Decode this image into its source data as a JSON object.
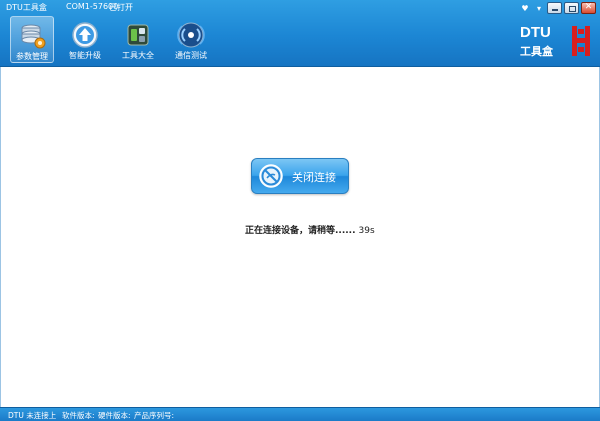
{
  "window": {
    "title": "DTU工具盒",
    "port": "COM1-57600",
    "port_status": "已打开"
  },
  "window_controls": {
    "help_glyph": "♥",
    "dropdown_glyph": "▾",
    "close_glyph": "✕"
  },
  "toolbar": {
    "items": [
      {
        "label": "参数管理",
        "icon": "database-settings-icon",
        "active": true
      },
      {
        "label": "智能升级",
        "icon": "upload-arrow-icon",
        "active": false
      },
      {
        "label": "工具大全",
        "icon": "toolbox-icon",
        "active": false
      },
      {
        "label": "通信测试",
        "icon": "signal-broadcast-icon",
        "active": false
      }
    ]
  },
  "brand": {
    "name": "DTU",
    "subtitle": "工具盒"
  },
  "main": {
    "close_button_label": "关闭连接",
    "status_message": "正在连接设备，请稍等......",
    "countdown": "39s"
  },
  "statusbar": {
    "connection": "DTU 未连接上",
    "software_version": "软件版本:",
    "hardware_version": "硬件版本:",
    "serial_number": "产品序列号:"
  },
  "colors": {
    "header_blue": "#1c86d4",
    "button_blue": "#3aa4ec",
    "brand_red": "#d81e1e"
  }
}
